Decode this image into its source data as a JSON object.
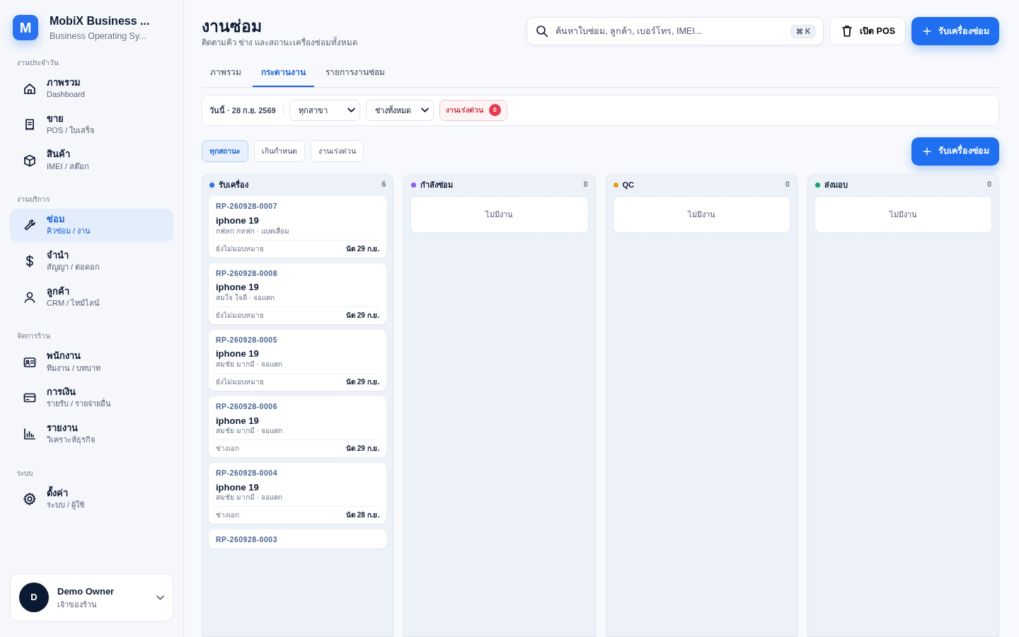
{
  "brand": {
    "logo": "M",
    "name": "MobiX Business ...",
    "subtitle": "Business Operating Sy..."
  },
  "sidebar": {
    "sections": [
      {
        "title": "งานประจำวัน",
        "items": [
          {
            "label": "ภาพรวม",
            "sub": "Dashboard",
            "selected": false
          },
          {
            "label": "ขาย",
            "sub": "POS / ใบเสร็จ",
            "selected": false
          },
          {
            "label": "สินค้า",
            "sub": "IMEI / สต๊อก",
            "selected": false
          }
        ]
      },
      {
        "title": "งานบริการ",
        "items": [
          {
            "label": "ซ่อม",
            "sub": "คิวซ่อม / งาน",
            "selected": true
          },
          {
            "label": "จำนำ",
            "sub": "สัญญา / ต่อดอก",
            "selected": false
          },
          {
            "label": "ลูกค้า",
            "sub": "CRM / ไทม์ไลน์",
            "selected": false
          }
        ]
      },
      {
        "title": "จัดการร้าน",
        "items": [
          {
            "label": "พนักงาน",
            "sub": "ทีมงาน / บทบาท",
            "selected": false
          },
          {
            "label": "การเงิน",
            "sub": "รายรับ / รายจ่ายอื่น",
            "selected": false
          },
          {
            "label": "รายงาน",
            "sub": "วิเคราะห์ธุรกิจ",
            "selected": false
          }
        ]
      },
      {
        "title": "ระบบ",
        "items": [
          {
            "label": "ตั้งค่า",
            "sub": "ระบบ / ผู้ใช้",
            "selected": false
          }
        ]
      }
    ]
  },
  "user": {
    "initial": "D",
    "name": "Demo Owner",
    "role": "เจ้าของร้าน"
  },
  "header": {
    "title": "งานซ่อม",
    "subtitle": "ติดตามคิว ช่าง และสถานะเครื่องซ่อมทั้งหมด"
  },
  "search": {
    "placeholder": "ค้นหาใบซ่อม, ลูกค้า, เบอร์โทร, IMEI...",
    "shortcut": "⌘ K"
  },
  "pos_button": "เปิด POS",
  "new_button": "รับเครื่องซ่อม",
  "tabs": [
    {
      "label": "ภาพรวม",
      "selected": false
    },
    {
      "label": "กระดานงาน",
      "selected": true
    },
    {
      "label": "รายการงานซ่อม",
      "selected": false
    }
  ],
  "toolbar": {
    "date": "วันนี้ · 28 ก.ย. 2569",
    "branch": "ทุกสาขา",
    "technician": "ช่างทั้งหมด",
    "urgent": {
      "label": "งานเร่งด่วน",
      "count": "0"
    }
  },
  "filters": [
    {
      "label": "ทุกสถานะ",
      "selected": true
    },
    {
      "label": "เกินกำหนด",
      "selected": false
    },
    {
      "label": "งานเร่งด่วน",
      "selected": false
    }
  ],
  "board_button": "รับเครื่องซ่อม",
  "columns": [
    {
      "title": "รับเครื่อง",
      "count": "6",
      "color": "#2f6fe8",
      "cards": [
        {
          "id": "RP-260928-0007",
          "model": "iphone 19",
          "detail": "กฟหก กหฟก · แบตเสื่อม",
          "assignee": "ยังไม่มอบหมาย",
          "due": "นัด 29 ก.ย."
        },
        {
          "id": "RP-260928-0008",
          "model": "iphone 19",
          "detail": "สมใจ ใจดี · จอแตก",
          "assignee": "ยังไม่มอบหมาย",
          "due": "นัด 29 ก.ย."
        },
        {
          "id": "RP-260928-0005",
          "model": "iphone 19",
          "detail": "สมชัย มากมี · จอแตก",
          "assignee": "ยังไม่มอบหมาย",
          "due": "นัด 29 ก.ย."
        },
        {
          "id": "RP-260928-0006",
          "model": "iphone 19",
          "detail": "สมชัย มากมี · จอแตก",
          "assignee": "ช่างเอก",
          "due": "นัด 29 ก.ย."
        },
        {
          "id": "RP-260928-0004",
          "model": "iphone 19",
          "detail": "สมชัย มากมี · จอแตก",
          "assignee": "ช่างเอก",
          "due": "นัด 28 ก.ย."
        },
        {
          "id": "RP-260928-0003"
        }
      ]
    },
    {
      "title": "กำลังซ่อม",
      "count": "0",
      "color": "#8b5cf6",
      "empty": "ไม่มีงาน"
    },
    {
      "title": "QC",
      "count": "0",
      "color": "#e4a11b",
      "empty": "ไม่มีงาน"
    },
    {
      "title": "ส่งมอบ",
      "count": "0",
      "color": "#16a36a",
      "empty": "ไม่มีงาน"
    }
  ]
}
